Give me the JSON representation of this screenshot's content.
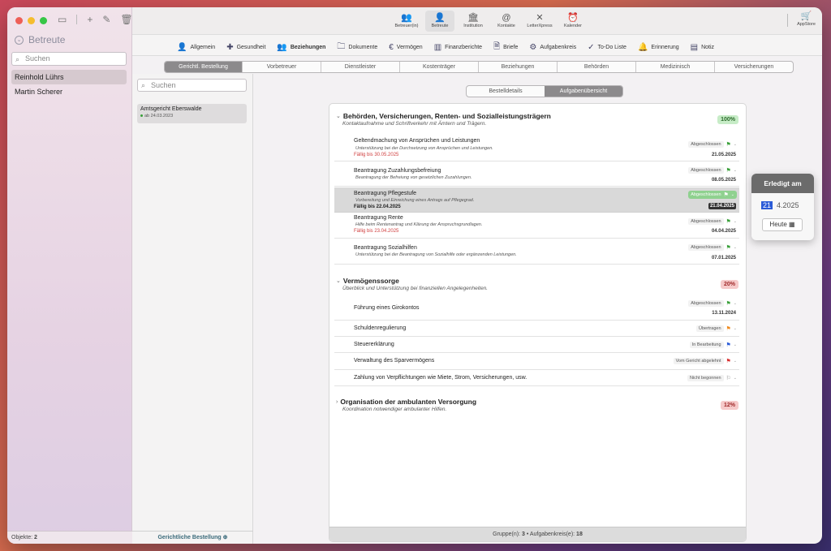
{
  "colors": {
    "accent": "#2a5bd7",
    "selection": "#d6c9cf",
    "done_green": "#7fcf7f",
    "due_red": "#d04040"
  },
  "sidebar": {
    "title": "Betreute",
    "search_placeholder": "Suchen",
    "items": [
      {
        "label": "Reinhold Lührs",
        "selected": true
      },
      {
        "label": "Martin Scherer",
        "selected": false
      }
    ],
    "footer_label": "Objekte:",
    "footer_count": "2"
  },
  "toolbar": {
    "buttons": [
      {
        "label": "Betreuer(in)",
        "icon": "person-group-icon"
      },
      {
        "label": "Betreute",
        "icon": "person-icon",
        "selected": true
      },
      {
        "label": "Institution",
        "icon": "building-icon"
      },
      {
        "label": "Kontakte",
        "icon": "contact-icon"
      },
      {
        "label": "LetterXpress",
        "icon": "letter-icon"
      },
      {
        "label": "Kalender",
        "icon": "clock-icon"
      }
    ],
    "appstore": "AppStore"
  },
  "nav": {
    "items": [
      {
        "label": "Allgemein"
      },
      {
        "label": "Gesundheit"
      },
      {
        "label": "Beziehungen",
        "selected": true
      },
      {
        "label": "Dokumente"
      },
      {
        "label": "Vermögen"
      },
      {
        "label": "Finanzberichte"
      },
      {
        "label": "Briefe"
      },
      {
        "label": "Aufgabenkreis"
      },
      {
        "label": "To-Do Liste"
      },
      {
        "label": "Erinnerung"
      },
      {
        "label": "Notiz"
      }
    ]
  },
  "tabs": [
    {
      "label": "Gerichtl. Bestellung",
      "selected": true
    },
    {
      "label": "Vorbetreuer"
    },
    {
      "label": "Dienstleister"
    },
    {
      "label": "Kostenträger"
    },
    {
      "label": "Beziehungen"
    },
    {
      "label": "Behörden"
    },
    {
      "label": "Medizinisch"
    },
    {
      "label": "Versicherungen"
    }
  ],
  "list": {
    "search_placeholder": "Suchen",
    "card_title": "Amtsgericht Eberswalde",
    "card_sub": "ab 24.03.2023",
    "footer": "Gerichtliche Bestellung"
  },
  "detail_tabs": [
    {
      "label": "Bestelldetails"
    },
    {
      "label": "Aufgabenübersicht",
      "selected": true
    }
  ],
  "groups": [
    {
      "title": "Behörden, Versicherungen, Renten- und Sozialleistungsträgern",
      "subtitle": "Kontaktaufnahme und Schriftverkehr mit Ämtern und Trägern.",
      "percent": "100%",
      "tasks": [
        {
          "title": "Geltendmachung von Ansprüchen und Leistungen",
          "sub": "Unterstützung bei der Durchsetzung von Ansprüchen und Leistungen.",
          "due": "Fällig bis 30.05.2025",
          "status": "Abgeschlossen",
          "date": "21.05.2025"
        },
        {
          "title": "Beantragung Zuzahlungsbefreiung",
          "sub": "Beantragung der Befreiung von gesetzlichen Zuzahlungen.",
          "due": "",
          "status": "Abgeschlossen",
          "date": "08.05.2025"
        },
        {
          "title": "Beantragung Pflegestufe",
          "sub": "Vorbereitung und Einreichung eines Antrags auf Pflegegrad.",
          "due": "Fällig bis 22.04.2025",
          "status": "Abgeschlossen",
          "date": "21.04.2025"
        },
        {
          "title": "Beantragung Rente",
          "sub": "Hilfe beim Rentenantrag und Klärung der Anspruchsgrundlagen.",
          "due": "Fällig bis 23.04.2025",
          "status": "Abgeschlossen",
          "date": "04.04.2025"
        },
        {
          "title": "Beantragung Sozialhilfen",
          "sub": "Unterstützung bei der Beantragung von Sozialhilfe oder ergänzenden Leistungen.",
          "due": "",
          "status": "Abgeschlossen",
          "date": "07.01.2025"
        }
      ]
    },
    {
      "title": "Vermögenssorge",
      "subtitle": "Überblick und Unterstützung bei finanziellen Angelegenheiten.",
      "percent": "20%",
      "tasks": [
        {
          "title": "Führung eines Girokontos",
          "status": "Abgeschlossen",
          "date": "13.11.2024"
        },
        {
          "title": "Schuldenregulierung",
          "status": "Übertragen",
          "date": ""
        },
        {
          "title": "Steuererklärung",
          "status": "In Bearbeitung",
          "date": ""
        },
        {
          "title": "Verwaltung des Sparvermögens",
          "status": "Vom Gericht abgelehnt",
          "date": ""
        },
        {
          "title": "Zahlung von Verpflichtungen wie Miete, Strom, Versicherungen, usw.",
          "status": "Nicht begonnen",
          "date": ""
        }
      ]
    },
    {
      "title": "Organisation der ambulanten Versorgung",
      "subtitle": "Koordination notwendiger ambulanter Hilfen.",
      "percent": "12%"
    }
  ],
  "panel_footer": {
    "groups_label": "Gruppe(n):",
    "groups_count": "3",
    "tasks_label": "• Aufgabenkreis(e):",
    "tasks_count": "18"
  },
  "popover": {
    "title": "Erledigt am",
    "day": "21",
    "rest": "4.2025",
    "today_button": "Heute"
  }
}
